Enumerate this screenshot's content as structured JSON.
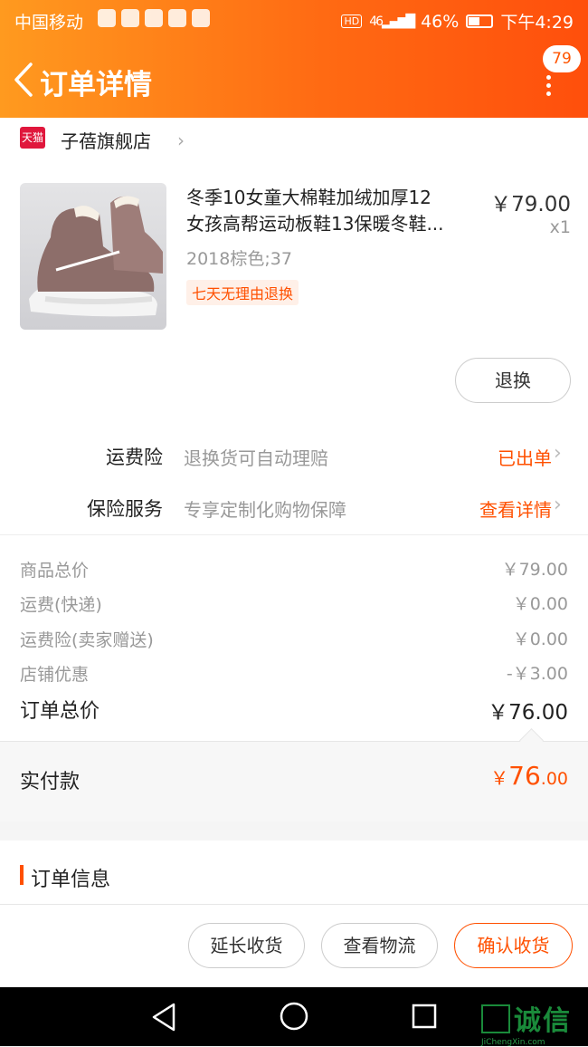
{
  "status_bar": {
    "carrier": "中国移动",
    "hd": "HD",
    "signal": "46",
    "battery": "46%",
    "time": "下午4:29"
  },
  "header": {
    "title": "订单详情",
    "badge_count": "79"
  },
  "shop": {
    "badge": "天猫",
    "name": "子蓓旗舰店"
  },
  "product": {
    "title_line1": "冬季10女童大棉鞋加绒加厚12",
    "title_line2": "女孩高帮运动板鞋13保暖冬鞋...",
    "price": "￥79.00",
    "quantity": "x1",
    "spec": "2018棕色;37",
    "tag": "七天无理由退换",
    "return_button": "退换"
  },
  "services": [
    {
      "label": "运费险",
      "desc": "退换货可自动理赔",
      "action": "已出单"
    },
    {
      "label": "保险服务",
      "desc": "专享定制化购物保障",
      "action": "查看详情"
    }
  ],
  "fees": [
    {
      "label": "商品总价",
      "value": "￥79.00"
    },
    {
      "label": "运费(快递)",
      "value": "￥0.00"
    },
    {
      "label": "运费险(卖家赠送)",
      "value": "￥0.00"
    },
    {
      "label": "店铺优惠",
      "value": "-￥3.00"
    }
  ],
  "order_total": {
    "label": "订单总价",
    "value": "￥76.00"
  },
  "paid": {
    "label": "实付款",
    "currency": "￥",
    "integer": "76",
    "decimal": ".00"
  },
  "order_info": {
    "title": "订单信息"
  },
  "actions": {
    "extend": "延长收货",
    "logistics": "查看物流",
    "confirm": "确认收货"
  },
  "watermark": {
    "brand": "诚信",
    "site": "JiChengXin.com"
  },
  "colors": {
    "accent": "#ff5000",
    "header_start": "#ff9a1f",
    "header_end": "#ff4f0c"
  }
}
